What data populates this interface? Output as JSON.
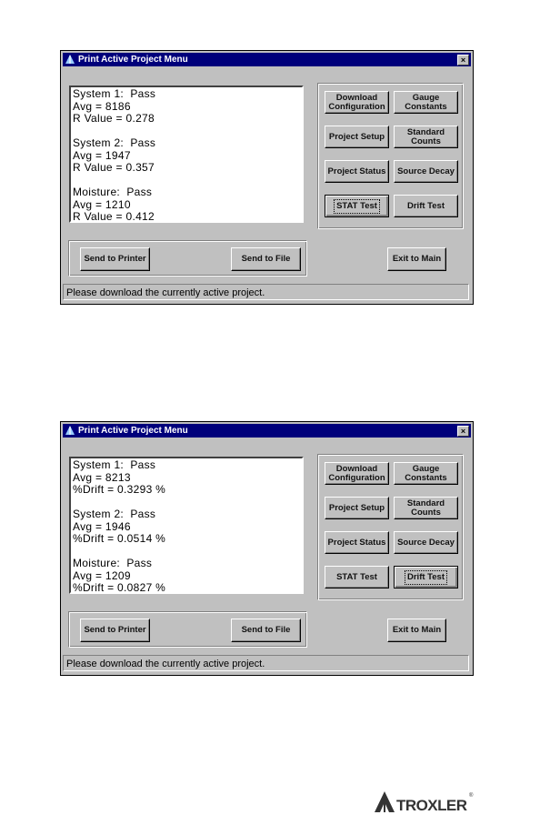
{
  "windows": [
    {
      "title": "Print Active Project Menu",
      "close_label": "×",
      "results": [
        "System 1:  Pass",
        "Avg = 8186",
        "R Value = 0.278",
        "",
        "System 2:  Pass",
        "Avg = 1947",
        "R Value = 0.357",
        "",
        "Moisture:  Pass",
        "Avg = 1210",
        "R Value = 0.412"
      ],
      "buttons": [
        "Download Configuration",
        "Gauge Constants",
        "Project Setup",
        "Standard Counts",
        "Project Status",
        "Source Decay",
        "STAT Test",
        "Drift Test"
      ],
      "focused_button": "STAT Test",
      "send_to_printer": "Send to Printer",
      "send_to_file": "Send to File",
      "exit_to_main": "Exit to Main",
      "status": "Please download the currently active project."
    },
    {
      "title": "Print Active Project Menu",
      "close_label": "×",
      "results": [
        "System 1:  Pass",
        "Avg = 8213",
        "%Drift = 0.3293 %",
        "",
        "System 2:  Pass",
        "Avg = 1946",
        "%Drift = 0.0514 %",
        "",
        "Moisture:  Pass",
        "Avg = 1209",
        "%Drift = 0.0827 %"
      ],
      "buttons": [
        "Download Configuration",
        "Gauge Constants",
        "Project Setup",
        "Standard Counts",
        "Project Status",
        "Source Decay",
        "STAT Test",
        "Drift Test"
      ],
      "focused_button": "Drift Test",
      "send_to_printer": "Send to Printer",
      "send_to_file": "Send to File",
      "exit_to_main": "Exit to Main",
      "status": "Please download the currently active project."
    }
  ],
  "logo": {
    "text": "TROXLER",
    "registered": "®"
  },
  "colors": {
    "titlebar": "#00007b",
    "face": "#c0c0c0"
  }
}
